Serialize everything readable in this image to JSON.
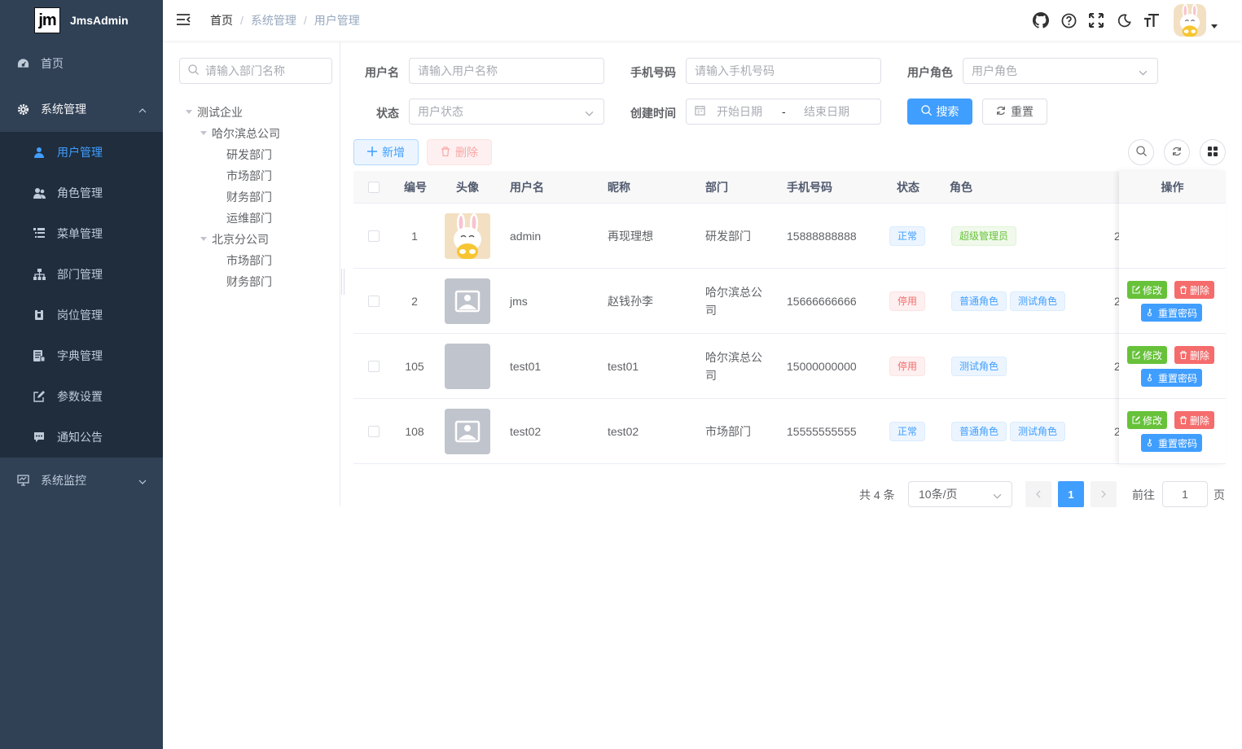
{
  "app": {
    "logo_text": "jm",
    "title": "JmsAdmin"
  },
  "sidebar": {
    "items": [
      {
        "label": "首页",
        "icon": "dashboard-icon"
      },
      {
        "label": "系统管理",
        "icon": "gear-icon",
        "expanded": true,
        "children": [
          {
            "label": "用户管理",
            "icon": "user-icon",
            "active": true
          },
          {
            "label": "角色管理",
            "icon": "peoples-icon"
          },
          {
            "label": "菜单管理",
            "icon": "tree-table-icon"
          },
          {
            "label": "部门管理",
            "icon": "tree-icon"
          },
          {
            "label": "岗位管理",
            "icon": "post-icon"
          },
          {
            "label": "字典管理",
            "icon": "dict-icon"
          },
          {
            "label": "参数设置",
            "icon": "edit-icon"
          },
          {
            "label": "通知公告",
            "icon": "message-icon"
          }
        ]
      },
      {
        "label": "系统监控",
        "icon": "monitor-icon"
      }
    ]
  },
  "breadcrumb": [
    "首页",
    "系统管理",
    "用户管理"
  ],
  "dept_tree": {
    "search_placeholder": "请输入部门名称",
    "nodes": [
      {
        "label": "测试企业",
        "level": 0,
        "expandable": true
      },
      {
        "label": "哈尔滨总公司",
        "level": 1,
        "expandable": true
      },
      {
        "label": "研发部门",
        "level": 2
      },
      {
        "label": "市场部门",
        "level": 2
      },
      {
        "label": "财务部门",
        "level": 2
      },
      {
        "label": "运维部门",
        "level": 2
      },
      {
        "label": "北京分公司",
        "level": 1,
        "expandable": true
      },
      {
        "label": "市场部门",
        "level": 2
      },
      {
        "label": "财务部门",
        "level": 2
      }
    ]
  },
  "search_form": {
    "username_label": "用户名",
    "username_placeholder": "请输入用户名称",
    "phone_label": "手机号码",
    "phone_placeholder": "请输入手机号码",
    "role_label": "用户角色",
    "role_placeholder": "用户角色",
    "status_label": "状态",
    "status_placeholder": "用户状态",
    "created_label": "创建时间",
    "start_placeholder": "开始日期",
    "range_sep": "-",
    "end_placeholder": "结束日期",
    "search_btn": "搜索",
    "reset_btn": "重置"
  },
  "toolbar": {
    "add_btn": "新增",
    "delete_btn": "删除"
  },
  "table": {
    "headers": {
      "id": "编号",
      "avatar": "头像",
      "username": "用户名",
      "nickname": "昵称",
      "dept": "部门",
      "phone": "手机号码",
      "status": "状态",
      "role": "角色",
      "ops": "操作"
    },
    "rows": [
      {
        "id": "1",
        "avatar": "rabbit",
        "username": "admin",
        "nickname": "再现理想",
        "dept": "研发部门",
        "phone": "15888888888",
        "status": "正常",
        "status_type": "primary",
        "roles": [
          {
            "name": "超级管理员",
            "type": "success"
          }
        ],
        "overflow": "2",
        "has_ops": false
      },
      {
        "id": "2",
        "avatar": "placeholder",
        "username": "jms",
        "nickname": "赵钱孙李",
        "dept": "哈尔滨总公司",
        "phone": "15666666666",
        "status": "停用",
        "status_type": "danger",
        "roles": [
          {
            "name": "普通角色",
            "type": "primary"
          },
          {
            "name": "测试角色",
            "type": "primary"
          }
        ],
        "overflow": "2",
        "has_ops": true
      },
      {
        "id": "105",
        "avatar": "blank",
        "username": "test01",
        "nickname": "test01",
        "dept": "哈尔滨总公司",
        "phone": "15000000000",
        "status": "停用",
        "status_type": "danger",
        "roles": [
          {
            "name": "测试角色",
            "type": "primary"
          }
        ],
        "overflow": "2",
        "has_ops": true
      },
      {
        "id": "108",
        "avatar": "placeholder",
        "username": "test02",
        "nickname": "test02",
        "dept": "市场部门",
        "phone": "15555555555",
        "status": "正常",
        "status_type": "primary",
        "roles": [
          {
            "name": "普通角色",
            "type": "primary"
          },
          {
            "name": "测试角色",
            "type": "primary"
          }
        ],
        "overflow": "2",
        "has_ops": true
      }
    ],
    "op_labels": {
      "edit": "修改",
      "delete": "删除",
      "reset_pwd": "重置密码"
    }
  },
  "pagination": {
    "total_text": "共 4 条",
    "page_size": "10条/页",
    "current": "1",
    "goto_label": "前往",
    "goto_value": "1",
    "page_suffix": "页"
  },
  "colors": {
    "primary": "#409eff",
    "success": "#67c23a",
    "danger": "#f56c6c",
    "sidebar_bg": "#304156",
    "submenu_bg": "#1f2d3d"
  }
}
